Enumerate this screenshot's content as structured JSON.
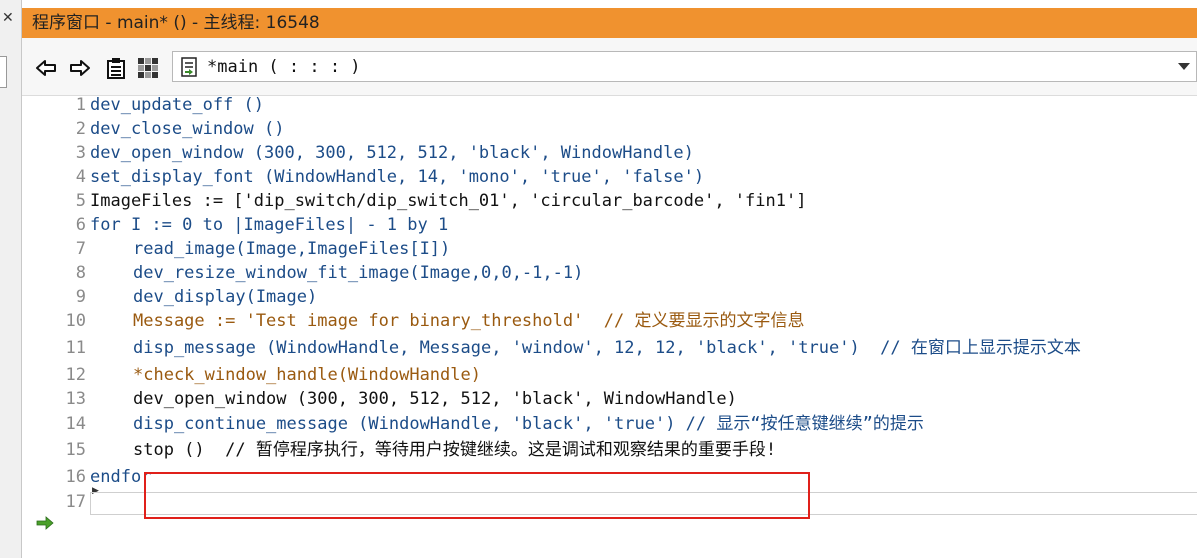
{
  "window": {
    "title": "程序窗口 - main* () - 主线程: 16548"
  },
  "toolbar": {
    "back_icon": "back-arrow-icon",
    "forward_icon": "forward-arrow-icon",
    "clipboard_icon": "clipboard-icon",
    "grid_icon": "grid-icon",
    "procedure": "*main ( : : : )"
  },
  "code": {
    "lines": [
      {
        "n": "1",
        "text": "dev_update_off ()"
      },
      {
        "n": "2",
        "text": "dev_close_window ()"
      },
      {
        "n": "3",
        "text": "dev_open_window (300, 300, 512, 512, 'black', WindowHandle)"
      },
      {
        "n": "4",
        "text": "set_display_font (WindowHandle, 14, 'mono', 'true', 'false')"
      },
      {
        "n": "5",
        "text": "ImageFiles := ['dip_switch/dip_switch_01', 'circular_barcode', 'fin1']"
      },
      {
        "n": "6",
        "text": "for I := 0 to |ImageFiles| - 1 by 1"
      },
      {
        "n": "7",
        "text": "read_image(Image,ImageFiles[I])"
      },
      {
        "n": "8",
        "text": "dev_resize_window_fit_image(Image,0,0,-1,-1)"
      },
      {
        "n": "9",
        "text": "dev_display(Image)"
      },
      {
        "n": "10",
        "text": "Message := 'Test image for binary_threshold'  // 定义要显示的文字信息"
      },
      {
        "n": "11",
        "text": "disp_message (WindowHandle, Message, 'window', 12, 12, 'black', 'true')  // 在窗口上显示提示文本"
      },
      {
        "n": "12",
        "text": "*check_window_handle(WindowHandle)"
      },
      {
        "n": "13",
        "text": "dev_open_window (300, 300, 512, 512, 'black', WindowHandle)"
      },
      {
        "n": "14",
        "text": "disp_continue_message (WindowHandle, 'black', 'true') // 显示“按任意键继续”的提示"
      },
      {
        "n": "15",
        "text": "stop ()  // 暂停程序执行，等待用户按键继续。这是调试和观察结果的重要手段!"
      },
      {
        "n": "16",
        "text": "endfor"
      },
      {
        "n": "17",
        "text": ""
      }
    ]
  },
  "colors": {
    "titlebar": "#f0922f",
    "keyword": "#1c4c88",
    "comment_orange": "#9a5a10",
    "highlight_box": "#e0201a",
    "exec_arrow": "#4aa02a"
  }
}
